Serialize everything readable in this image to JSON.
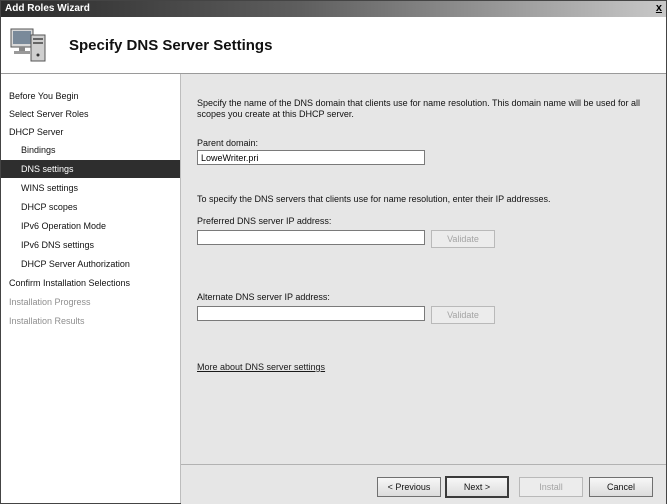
{
  "window": {
    "title": "Add Roles Wizard",
    "close_label": "x"
  },
  "header": {
    "icon": "server-computer-icon",
    "title": "Specify DNS Server Settings"
  },
  "nav": {
    "items": [
      {
        "label": "Before You Begin",
        "level": 0,
        "state": "normal"
      },
      {
        "label": "Select Server Roles",
        "level": 0,
        "state": "normal"
      },
      {
        "label": "DHCP Server",
        "level": 0,
        "state": "normal"
      },
      {
        "label": "Bindings",
        "level": 1,
        "state": "normal"
      },
      {
        "label": "DNS settings",
        "level": 1,
        "state": "selected"
      },
      {
        "label": "WINS settings",
        "level": 1,
        "state": "normal"
      },
      {
        "label": "DHCP scopes",
        "level": 1,
        "state": "normal"
      },
      {
        "label": "IPv6 Operation Mode",
        "level": 1,
        "state": "normal"
      },
      {
        "label": "IPv6 DNS settings",
        "level": 1,
        "state": "normal"
      },
      {
        "label": "DHCP Server Authorization",
        "level": 1,
        "state": "normal"
      },
      {
        "label": "Confirm Installation Selections",
        "level": 0,
        "state": "normal"
      },
      {
        "label": "Installation Progress",
        "level": 0,
        "state": "disabled"
      },
      {
        "label": "Installation Results",
        "level": 0,
        "state": "disabled"
      }
    ]
  },
  "main": {
    "description": "Specify the name of the DNS domain that clients use for name resolution. This domain name will be used for all scopes you create at this DHCP server.",
    "parent_domain_label": "Parent domain:",
    "parent_domain_value": "LoweWriter.pri",
    "dns_instruction": "To specify the DNS servers that clients use for name resolution, enter their IP addresses.",
    "preferred_label": "Preferred DNS server IP address:",
    "preferred_value": "",
    "alternate_label": "Alternate DNS server IP address:",
    "alternate_value": "",
    "validate_label": "Validate",
    "more_link": "More about DNS server settings"
  },
  "footer": {
    "previous": "< Previous",
    "next": "Next >",
    "install": "Install",
    "cancel": "Cancel"
  },
  "colors": {
    "selected_nav_bg": "#2e2e2e",
    "content_bg": "#e6e6e6",
    "titlebar_dark": "#2a2a2a"
  }
}
